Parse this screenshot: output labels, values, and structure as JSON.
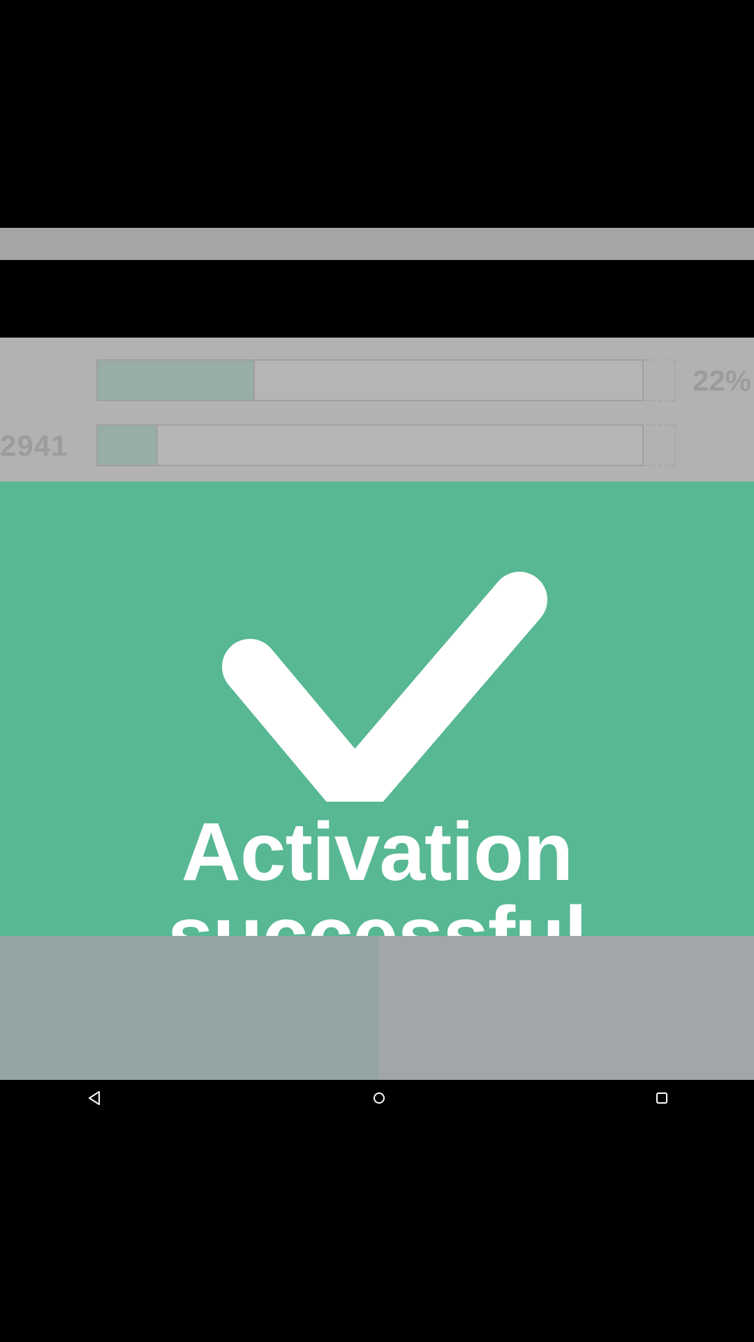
{
  "progress": {
    "rows": [
      {
        "label": "",
        "percent_text": "22%",
        "fill_fraction": 0.288
      },
      {
        "label": "2941",
        "percent_text": "",
        "fill_fraction": 0.11
      }
    ]
  },
  "success": {
    "icon": "checkmark-icon",
    "message": "Activation successful",
    "color": "#57b893"
  },
  "nav": {
    "back_icon": "back-triangle-icon",
    "home_icon": "home-circle-icon",
    "recents_icon": "recents-square-icon"
  }
}
